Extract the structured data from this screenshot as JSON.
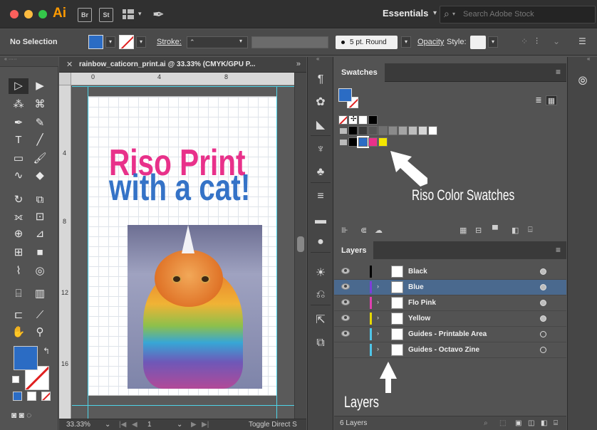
{
  "app": {
    "logo": "Ai",
    "bridge_label": "Br",
    "stock_label": "St",
    "workspace": "Essentials",
    "stock_search_placeholder": "Search Adobe Stock"
  },
  "control_bar": {
    "selection_label": "No Selection",
    "fill_color": "#2b6cc4",
    "stroke_label": "Stroke:",
    "brush_label": "5 pt. Round",
    "opacity_label": "Opacity",
    "style_label": "Style:"
  },
  "document": {
    "tab_title": "rainbow_caticorn_print.ai @ 33.33% (CMYK/GPU P...",
    "ruler_h_marks": [
      "0",
      "4",
      "8"
    ],
    "ruler_v_marks": [
      "4",
      "8",
      "12",
      "16"
    ],
    "artwork_line1": "Riso Print",
    "artwork_line2": "with a cat!",
    "zoom": "33.33%",
    "page_number": "1",
    "status": "Toggle Direct S"
  },
  "swatches_panel": {
    "title": "Swatches",
    "row1": [
      "#ffffff",
      "#000000"
    ],
    "row2": [
      "#000000",
      "#3a3a3a",
      "#555555",
      "#6f6f6f",
      "#8a8a8a",
      "#a4a4a4",
      "#bdbdbd",
      "#d6d6d6",
      "#ffffff"
    ],
    "row3": [
      "#000000",
      "#2b6cc4",
      "#e8318a",
      "#f4e600"
    ]
  },
  "annotations": {
    "swatches": "Riso Color Swatches",
    "layers": "Layers"
  },
  "layers_panel": {
    "title": "Layers",
    "layers": [
      {
        "name": "Black",
        "color": "#000000",
        "target_filled": true
      },
      {
        "name": "Blue",
        "color": "#7d3ed9",
        "target_filled": true
      },
      {
        "name": "Flo Pink",
        "color": "#e040b0",
        "target_filled": true
      },
      {
        "name": "Yellow",
        "color": "#e6d800",
        "target_filled": true
      },
      {
        "name": "Guides - Printable Area",
        "color": "#4fc5e8",
        "target_filled": false
      },
      {
        "name": "Guides - Octavo Zine",
        "color": "#4fc5e8",
        "target_filled": false
      }
    ],
    "count_label": "6 Layers"
  },
  "icons": {
    "close": "close-icon",
    "search": "search-icon",
    "eye": "eye-icon",
    "trash": "trash-icon",
    "panel_menu": "panel-menu-icon"
  }
}
